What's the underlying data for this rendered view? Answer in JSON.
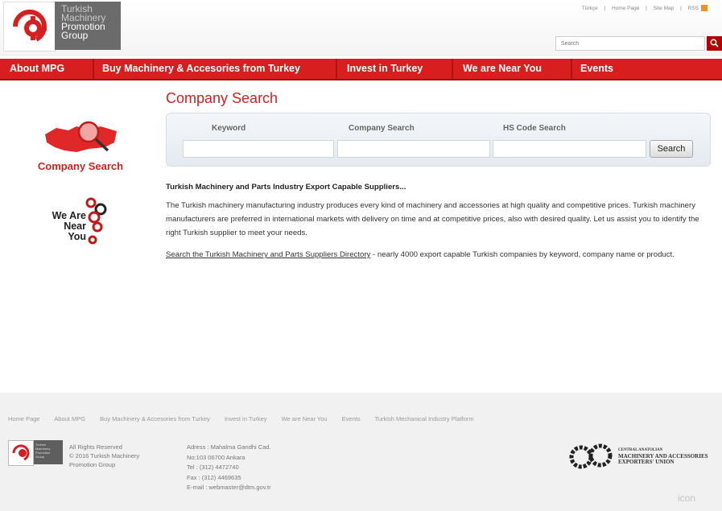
{
  "header": {
    "logo_lines": [
      "Turkish",
      "Machinery",
      "Promotion",
      "Group"
    ],
    "top_links": [
      "Türkçe",
      "|",
      "Home Page",
      "|",
      "Site Map",
      "|",
      "RSS"
    ],
    "search_placeholder": "Search"
  },
  "nav": {
    "items": [
      {
        "label": "About MPG"
      },
      {
        "label": "Buy Machinery & Accesories from Turkey"
      },
      {
        "label": "Invest in Turkey"
      },
      {
        "label": "We are Near You"
      },
      {
        "label": "Events"
      }
    ]
  },
  "sidebar": {
    "company_search_label": "Company Search",
    "near_label": [
      "We Are",
      "Near",
      "You"
    ]
  },
  "main": {
    "title": "Company Search",
    "search_panel": {
      "keyword_label": "Keyword",
      "company_label": "Company Search",
      "hs_label": "HS Code Search",
      "button_label": "Search"
    },
    "intro_title": "Turkish Machinery and Parts Industry Export Capable Suppliers...",
    "body_text": "The Turkish machinery manufacturing industry produces every kind of machinery and accessories at high quality and competitive prices. Turkish machinery manufacturers are preferred in international markets with delivery on time and at competitive prices, also with desired quality. Let us assist you to identify the right Turkish supplier to meet your needs.",
    "directory_link": "Search the Turkish Machinery and Parts Suppliers Directory",
    "directory_rest": " - nearly 4000 export capable Turkish companies by keyword, company name or product."
  },
  "footer": {
    "links": [
      "Home Page",
      "About MPG",
      "Buy Machinery & Accesories from Turkey",
      "Invest in Turkey",
      "We are Near You",
      "Events",
      "Turkish Mechanical Industry Platform"
    ],
    "logo_lines": [
      "Turkish",
      "Machinery",
      "Promotion",
      "Group"
    ],
    "rights": [
      "All Rights Reserved",
      "© 2016 Turkish Machinery",
      "Promotion Group"
    ],
    "address": [
      "Adress : Mahalma Gandhi Cad.",
      "No:103 06700 Ankara",
      "Tel : (312) 4472740",
      "Fax : (312) 4469635",
      "E-mail : webmaster@dtm.gov.tr"
    ],
    "partner_lines": [
      "CENTRAL ANATOLIAN",
      "MACHINERY AND ACCESSORIES",
      "EXPORTERS' UNION"
    ],
    "icon_mark": "icon"
  },
  "colors": {
    "brand_red": "#d81f1f",
    "title_red": "#d42020"
  }
}
